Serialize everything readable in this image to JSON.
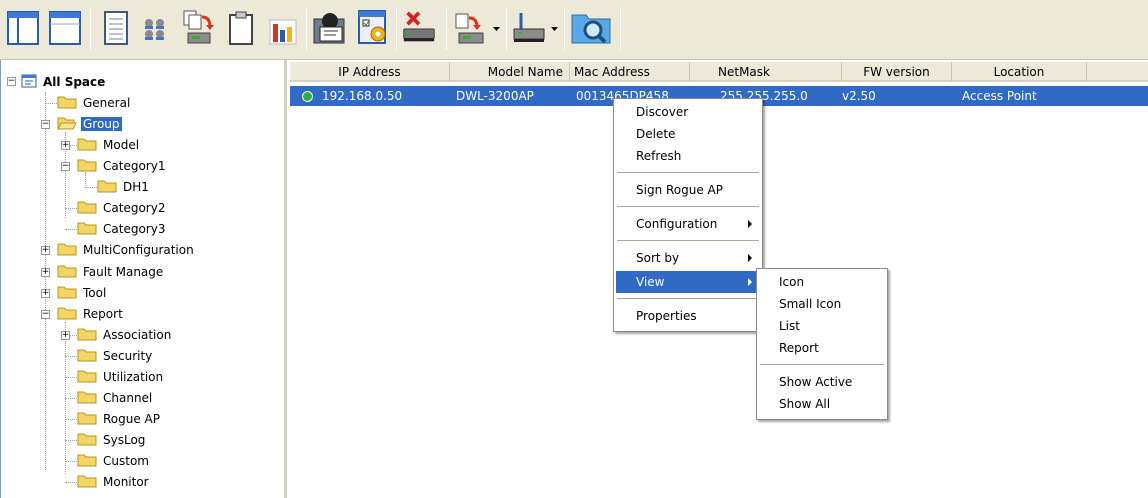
{
  "toolbar": {
    "buttons": [
      {
        "name": "tree-view-icon"
      },
      {
        "name": "list-view-icon"
      },
      {
        "name": "calculator-icon"
      },
      {
        "name": "users-group-icon"
      },
      {
        "name": "copy-config-icon"
      },
      {
        "name": "clipboard-icon"
      },
      {
        "name": "bar-chart-icon"
      },
      {
        "name": "user-management-icon"
      },
      {
        "name": "settings-window-icon"
      },
      {
        "name": "delete-device-icon"
      },
      {
        "name": "firmware-upgrade-icon"
      },
      {
        "name": "device-network-icon"
      },
      {
        "name": "discover-search-icon"
      }
    ]
  },
  "tree": {
    "root": "All Space",
    "nodes": [
      {
        "label": "General"
      },
      {
        "label": "Group"
      },
      {
        "label": "Model"
      },
      {
        "label": "Category1"
      },
      {
        "label": "DH1"
      },
      {
        "label": "Category2"
      },
      {
        "label": "Category3"
      },
      {
        "label": "MultiConfiguration"
      },
      {
        "label": "Fault Manage"
      },
      {
        "label": "Tool"
      },
      {
        "label": "Report"
      },
      {
        "label": "Association"
      },
      {
        "label": "Security"
      },
      {
        "label": "Utilization"
      },
      {
        "label": "Channel"
      },
      {
        "label": "Rogue AP"
      },
      {
        "label": "SysLog"
      },
      {
        "label": "Custom"
      },
      {
        "label": "Monitor"
      }
    ]
  },
  "table": {
    "columns": [
      "IP Address",
      "Model Name",
      "Mac Address",
      "NetMask",
      "FW version",
      "Location"
    ],
    "rows": [
      [
        "192.168.0.50",
        "DWL-3200AP",
        "0013465DP458",
        "255.255.255.0",
        "v2.50",
        "Access Point"
      ]
    ],
    "status_color": "#22b14c"
  },
  "context_menu": {
    "items": [
      "Discover",
      "Delete",
      "Refresh",
      "Sign Rogue AP",
      "Configuration",
      "Sort by",
      "View",
      "Properties"
    ],
    "highlighted": "View"
  },
  "view_submenu": {
    "items": [
      "Icon",
      "Small Icon",
      "List",
      "Report",
      "Show Active",
      "Show All"
    ]
  },
  "colors": {
    "selection": "#316ac5",
    "toolbar_bg": "#ece9d8"
  }
}
